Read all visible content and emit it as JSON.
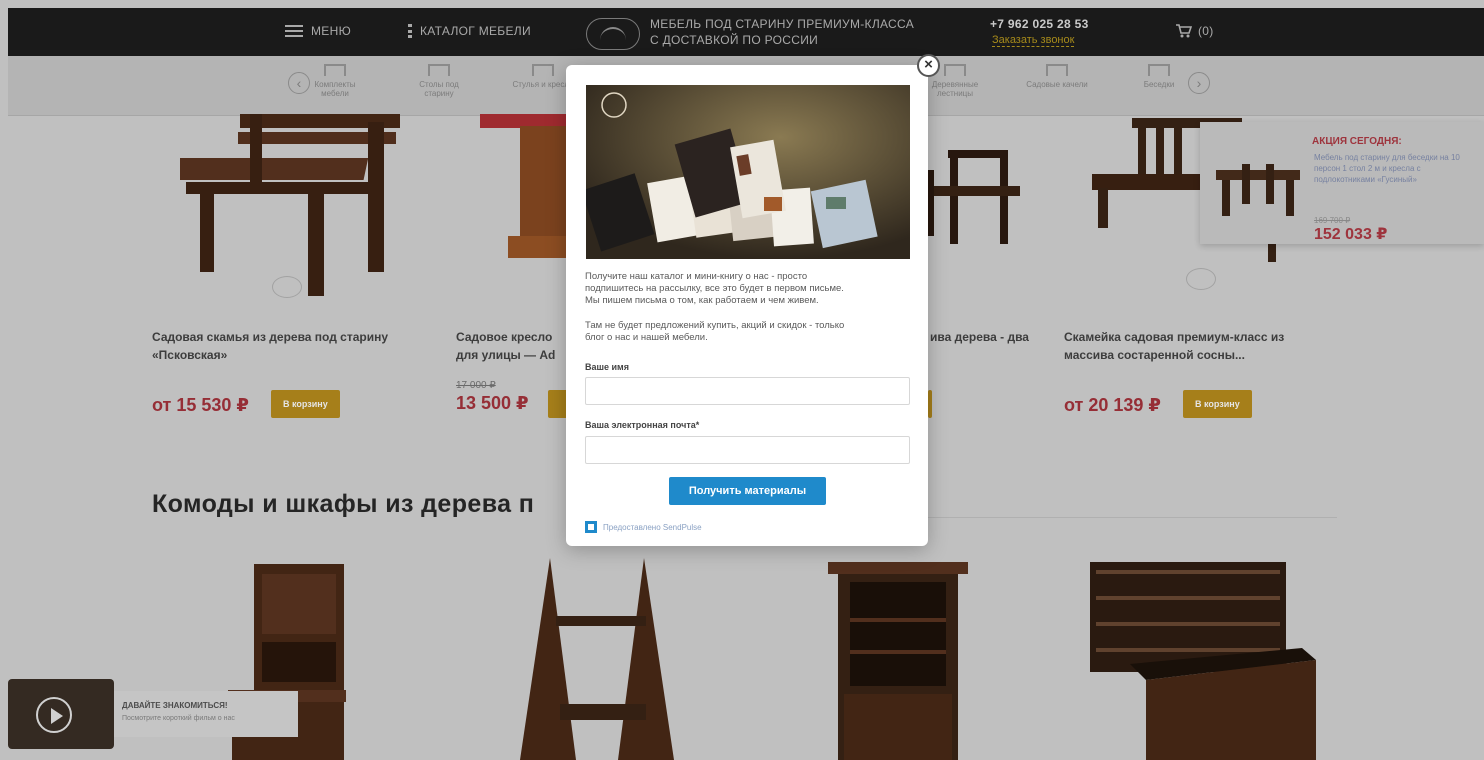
{
  "header": {
    "menu_label": "МЕНЮ",
    "catalog_label": "КАТАЛОГ МЕБЕЛИ",
    "tagline_line1": "МЕБЕЛЬ ПОД СТАРИНУ ПРЕМИУМ-КЛАССА",
    "tagline_line2": "С ДОСТАВКОЙ ПО РОССИИ",
    "phone": "+7 962 025 28 53",
    "callback": "Заказать звонок",
    "cart_count": "(0)"
  },
  "categories": [
    {
      "label": "Комплекты мебели"
    },
    {
      "label": "Столы под старину"
    },
    {
      "label": "Стулья и кресла"
    },
    {
      "label": "Деревянные лестницы"
    },
    {
      "label": "Садовые качели"
    },
    {
      "label": "Беседки"
    }
  ],
  "products": [
    {
      "title_line1": "Садовая скамья из дерева под старину",
      "title_line2": "«Псковская»",
      "price": "от 15 530 ₽",
      "cart_label": "В корзину"
    },
    {
      "title_line1": "Садовое кресло",
      "title_line2": "для улицы — Ad",
      "old_price": "17 000 ₽",
      "price": "13 500 ₽"
    },
    {
      "title_line1": "ива дерева - два"
    },
    {
      "title_line1": "Скамейка садовая премиум-класс из",
      "title_line2": "массива состаренной сосны...",
      "price": "от 20 139 ₽",
      "cart_label": "В корзину"
    }
  ],
  "section_title": "Комоды и шкафы из дерева п",
  "promo": {
    "title": "АКЦИЯ СЕГОДНЯ:",
    "text": "Мебель под старину для беседки на 10 персон 1 стол 2 м и кресла с подлокотниками «Гусиный»",
    "old_price": "169 700 ₽",
    "price": "152 033 ₽"
  },
  "video": {
    "title": "ДАВАЙТЕ ЗНАКОМИТЬСЯ!",
    "subtitle": "Посмотрите короткий фильм о нас"
  },
  "modal": {
    "desc_line1": "Получите наш каталог и мини-книгу о нас - просто",
    "desc_line2": "подпишитесь на рассылку, все это будет в первом письме.",
    "desc_line3": "Мы пишем письма о том, как работаем и чем живем.",
    "desc2_line1": "Там не будет предложений купить, акций и скидок - только",
    "desc2_line2": "блог о нас и нашей мебели.",
    "name_label": "Ваше имя",
    "email_label": "Ваша электронная почта*",
    "submit_label": "Получить материалы",
    "footer": "Предоставлено SendPulse"
  },
  "colors": {
    "header_bg": "#1e1e1e",
    "price_red": "#a8343d",
    "cart_button": "#b98e1e",
    "submit_blue": "#1f8acb"
  }
}
